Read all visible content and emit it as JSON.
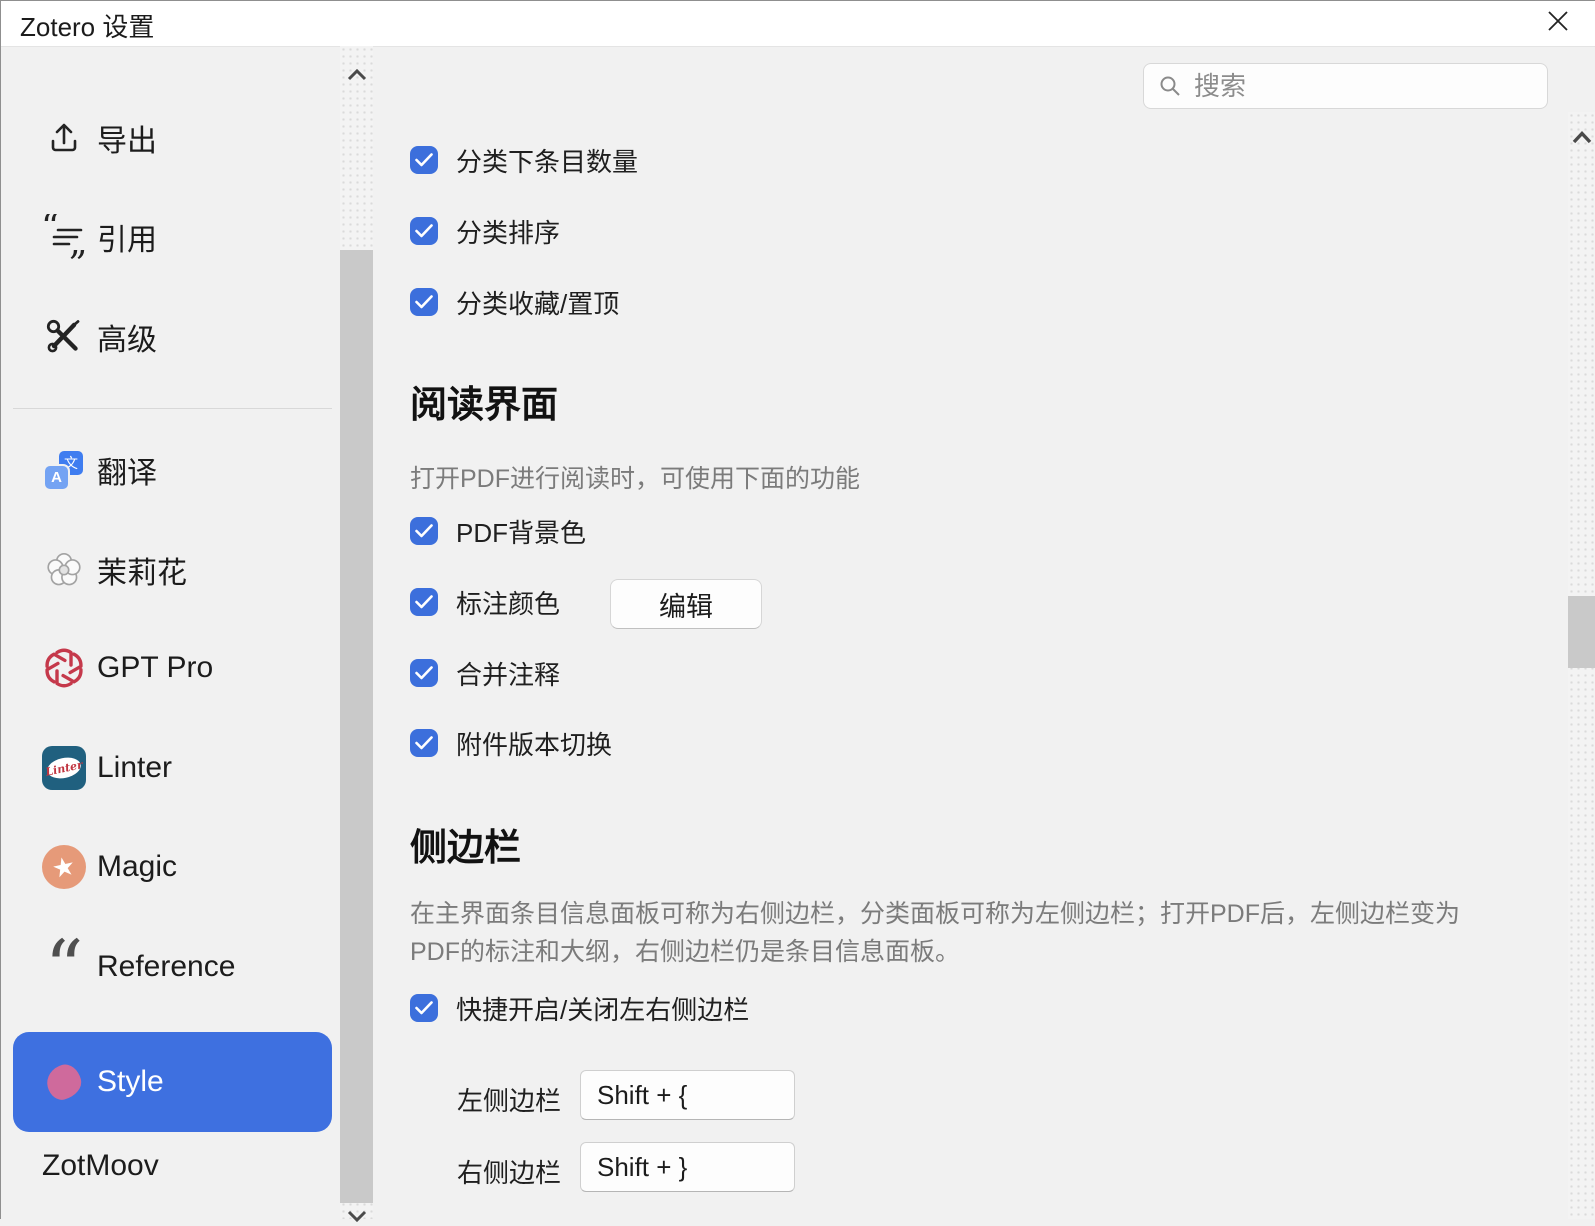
{
  "window": {
    "title": "Zotero 设置"
  },
  "search": {
    "placeholder": "搜索"
  },
  "sidebar": {
    "items": [
      {
        "label": "导出"
      },
      {
        "label": "引用"
      },
      {
        "label": "高级"
      },
      {
        "label": "翻译"
      },
      {
        "label": "茉莉花"
      },
      {
        "label": "GPT Pro"
      },
      {
        "label": "Linter"
      },
      {
        "label": "Magic"
      },
      {
        "label": "Reference"
      },
      {
        "label": "Style",
        "selected": true
      },
      {
        "label": "ZotMoov"
      }
    ],
    "linter_badge_text": "Linter",
    "translate_icon_chars": {
      "front": "A",
      "back": "文"
    }
  },
  "main": {
    "top_checkboxes": [
      {
        "label": "分类下条目数量",
        "checked": true
      },
      {
        "label": "分类排序",
        "checked": true
      },
      {
        "label": "分类收藏/置顶",
        "checked": true
      }
    ],
    "reading": {
      "heading": "阅读界面",
      "description": "打开PDF进行阅读时，可使用下面的功能",
      "items": [
        {
          "label": "PDF背景色",
          "checked": true
        },
        {
          "label": "标注颜色",
          "checked": true,
          "button_label": "编辑"
        },
        {
          "label": "合并注释",
          "checked": true
        },
        {
          "label": "附件版本切换",
          "checked": true
        }
      ]
    },
    "sidebar_section": {
      "heading": "侧边栏",
      "description": "在主界面条目信息面板可称为右侧边栏，分类面板可称为左侧边栏；打开PDF后，左侧边栏变为PDF的标注和大纲，右侧边栏仍是条目信息面板。",
      "checkbox": {
        "label": "快捷开启/关闭左右侧边栏",
        "checked": true
      },
      "shortcuts": [
        {
          "label": "左侧边栏",
          "value": "Shift + {"
        },
        {
          "label": "右侧边栏",
          "value": "Shift + }"
        }
      ]
    }
  },
  "colors": {
    "accent_blue": "#3c6fdc",
    "selected_blue": "#3e70e0",
    "style_pink": "#cf6a9c",
    "gpt_red": "#c5394b",
    "linter_teal": "#20607f",
    "magic_orange": "#e69a79",
    "background": "#f1f1f1"
  }
}
